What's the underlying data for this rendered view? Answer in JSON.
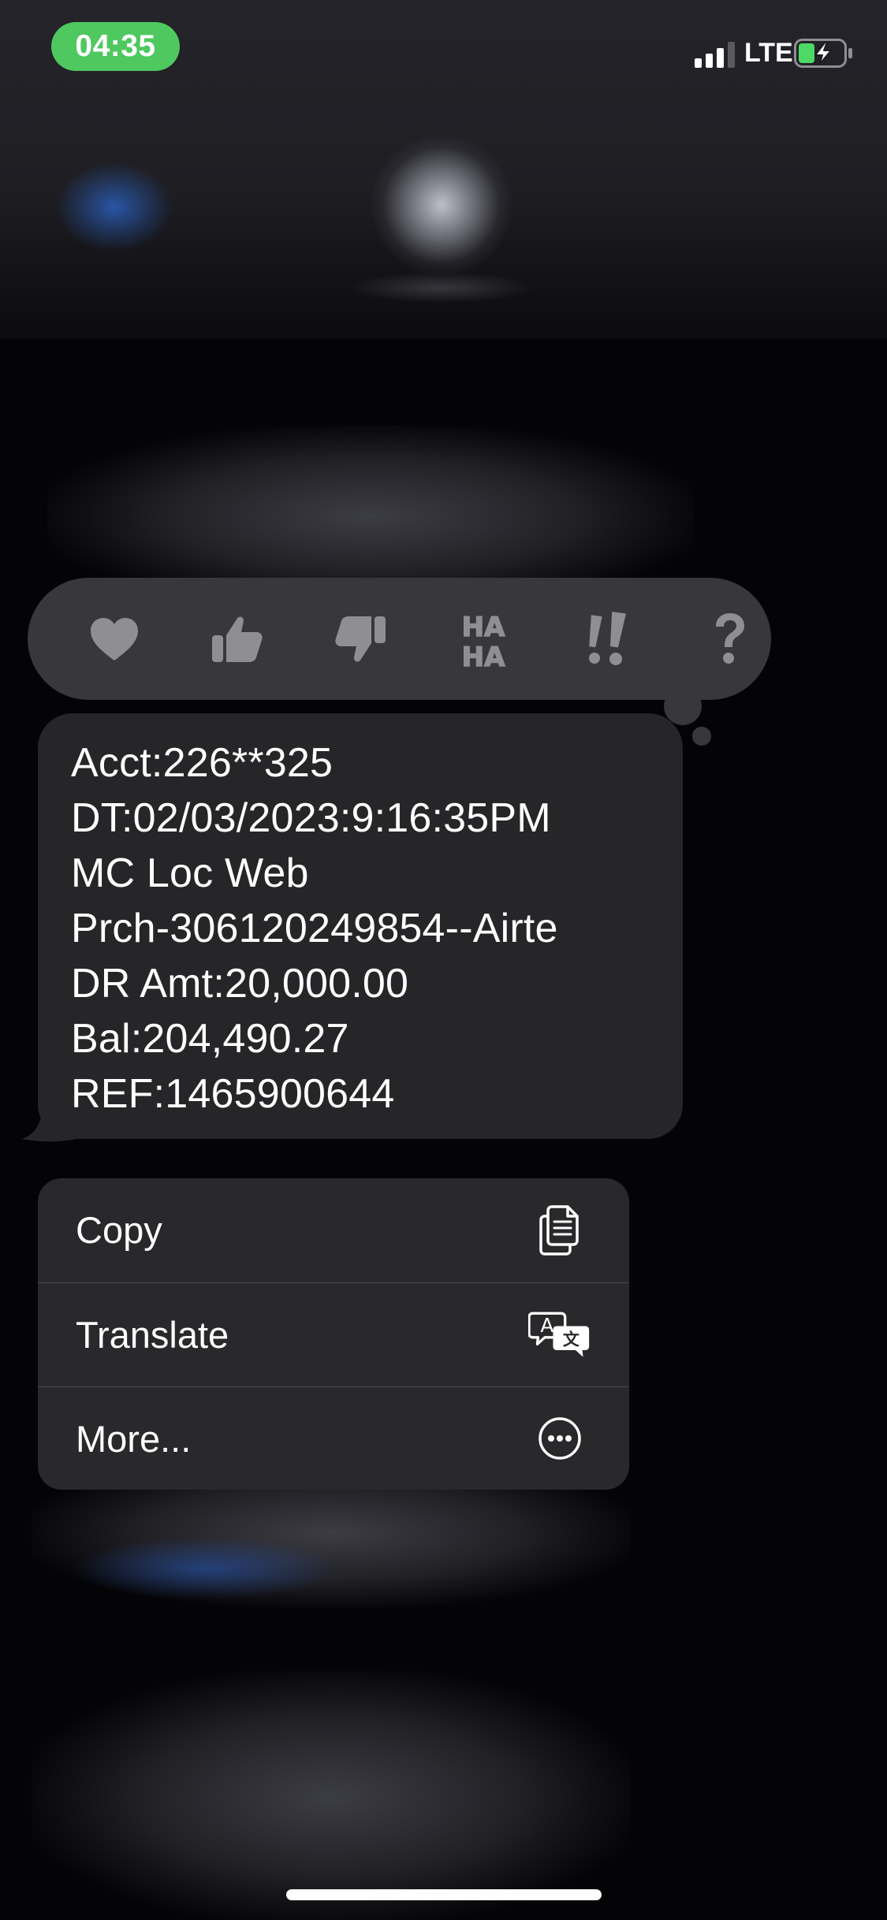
{
  "status_bar": {
    "time": "04:35",
    "network": "LTE",
    "signal_bars": 3,
    "signal_bars_total": 4,
    "battery_charging": true,
    "time_pill_color": "#4fc85f"
  },
  "tapback": {
    "reactions": [
      {
        "name": "heart",
        "icon": "heart-icon"
      },
      {
        "name": "thumbs-up",
        "icon": "thumbs-up-icon"
      },
      {
        "name": "thumbs-down",
        "icon": "thumbs-down-icon"
      },
      {
        "name": "haha",
        "icon": "haha-icon",
        "text_top": "HA",
        "text_bottom": "HA"
      },
      {
        "name": "emphasize",
        "icon": "double-exclamation-icon",
        "text": "!!"
      },
      {
        "name": "question",
        "icon": "question-icon",
        "text": "?"
      }
    ]
  },
  "message": {
    "lines": [
      "Acct:226**325",
      "DT:02/03/2023:9:16:35PM",
      "MC Loc Web",
      "Prch-306120249854--Airte",
      "DR Amt:20,000.00",
      "Bal:204,490.27",
      "REF:1465900644"
    ]
  },
  "menu": {
    "items": [
      {
        "label": "Copy",
        "icon": "copy-icon"
      },
      {
        "label": "Translate",
        "icon": "translate-icon",
        "glyph_a": "A",
        "glyph_b": "文"
      },
      {
        "label": "More...",
        "icon": "more-icon"
      }
    ]
  },
  "colors": {
    "bubble": "#262628",
    "menu": "#29292c",
    "tapback": "#38383c",
    "reaction_icon": "#8e8e93"
  }
}
